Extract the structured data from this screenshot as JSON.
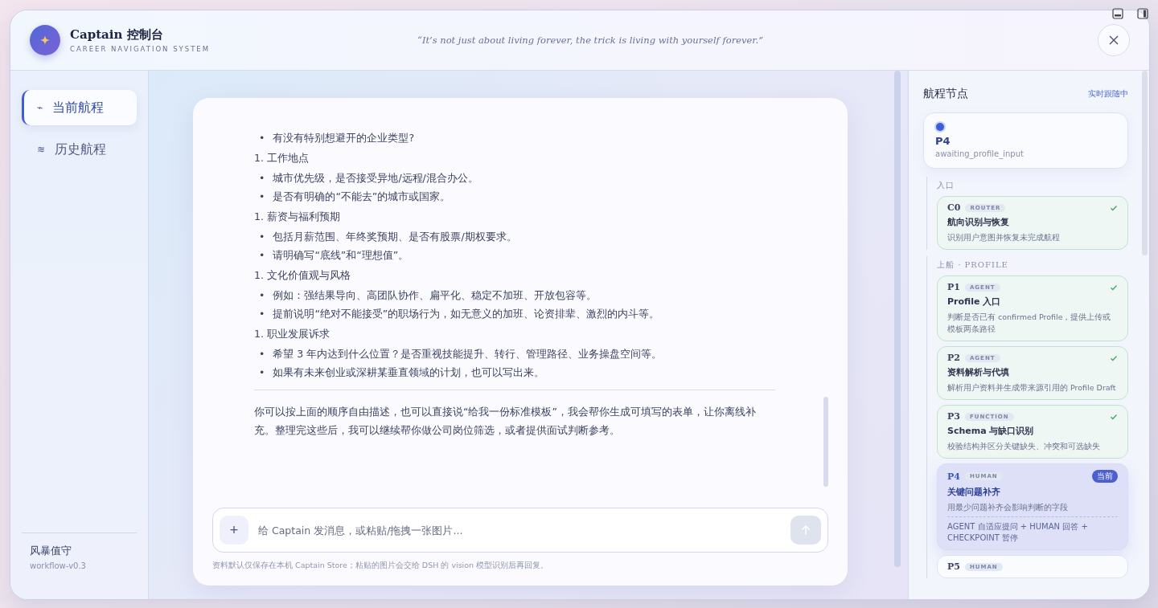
{
  "header": {
    "title": "Captain 控制台",
    "subtitle": "CAREER NAVIGATION SYSTEM",
    "quote": "“It’s not just about living forever, the trick is living with yourself forever.”"
  },
  "sidebar": {
    "items": [
      {
        "icon": "⌁",
        "label": "当前航程",
        "selected": true
      },
      {
        "icon": "≋",
        "label": "历史航程",
        "selected": false
      }
    ],
    "footer": {
      "title": "风暴值守",
      "version": "workflow-v0.3"
    }
  },
  "chat": {
    "blocks": [
      {
        "kind": "bullets",
        "marker": "•",
        "items": [
          "有没有特别想避开的企业类型?"
        ]
      },
      {
        "kind": "numbered",
        "number": "1.",
        "text": "工作地点"
      },
      {
        "kind": "bullets",
        "marker": "•",
        "items": [
          "城市优先级，是否接受异地/远程/混合办公。",
          "是否有明确的“不能去”的城市或国家。"
        ]
      },
      {
        "kind": "numbered",
        "number": "1.",
        "text": "薪资与福利预期"
      },
      {
        "kind": "bullets",
        "marker": "•",
        "items": [
          "包括月薪范围、年终奖预期、是否有股票/期权要求。",
          "请明确写“底线”和“理想值”。"
        ]
      },
      {
        "kind": "numbered",
        "number": "1.",
        "text": "文化价值观与风格"
      },
      {
        "kind": "bullets",
        "marker": "•",
        "items": [
          "例如：强结果导向、高团队协作、扁平化、稳定不加班、开放包容等。",
          "提前说明“绝对不能接受”的职场行为，如无意义的加班、论资排辈、激烈的内斗等。"
        ]
      },
      {
        "kind": "numbered",
        "number": "1.",
        "text": "职业发展诉求"
      },
      {
        "kind": "bullets",
        "marker": "•",
        "items": [
          "希望 3 年内达到什么位置？是否重视技能提升、转行、管理路径、业务操盘空间等。",
          "如果有未来创业或深耕某垂直领域的计划，也可以写出来。"
        ]
      },
      {
        "kind": "rule"
      },
      {
        "kind": "paragraph",
        "text": "你可以按上面的顺序自由描述，也可以直接说“给我一份标准模板”，我会帮你生成可填写的表单，让你离线补充。整理完这些后，我可以继续帮你做公司岗位筛选，或者提供面试判断参考。"
      }
    ],
    "input": {
      "placeholder": "给 Captain 发消息，或粘贴/拖拽一张图片...",
      "add": "+",
      "disabled": true
    },
    "note": "资料默认仅保存在本机 Captain Store；粘贴的图片会交给 DSH 的 vision 模型识别后再回复。"
  },
  "timeline": {
    "title": "航程节点",
    "status": "实时跟随中",
    "current": {
      "id": "P4",
      "state": "awaiting_profile_input"
    },
    "groups": [
      {
        "label": "入口",
        "nodes": [
          {
            "id": "C0",
            "tag": "ROUTER",
            "title": "航向识别与恢复",
            "desc": "识别用户意图并恢复未完成航程",
            "kind": "done"
          }
        ]
      },
      {
        "label": "上船 · PROFILE",
        "nodes": [
          {
            "id": "P1",
            "tag": "AGENT",
            "title": "Profile 入口",
            "desc": "判断是否已有 confirmed Profile，提供上传或模板两条路径",
            "kind": "done"
          },
          {
            "id": "P2",
            "tag": "AGENT",
            "title": "资料解析与代填",
            "desc": "解析用户资料并生成带来源引用的 Profile Draft",
            "kind": "done"
          },
          {
            "id": "P3",
            "tag": "FUNCTION",
            "title": "Schema 与缺口识别",
            "desc": "校验结构并区分关键缺失、冲突和可选缺失",
            "kind": "done"
          },
          {
            "id": "P4",
            "tag": "HUMAN",
            "title": "关键问题补齐",
            "desc": "用最少问题补齐会影响判断的字段",
            "badge": "当前",
            "detail": "AGENT 自适应提问 + HUMAN 回答 + CHECKPOINT 暂停",
            "kind": "current"
          },
          {
            "id": "P5",
            "tag": "HUMAN",
            "kind": "pending"
          }
        ]
      }
    ]
  }
}
